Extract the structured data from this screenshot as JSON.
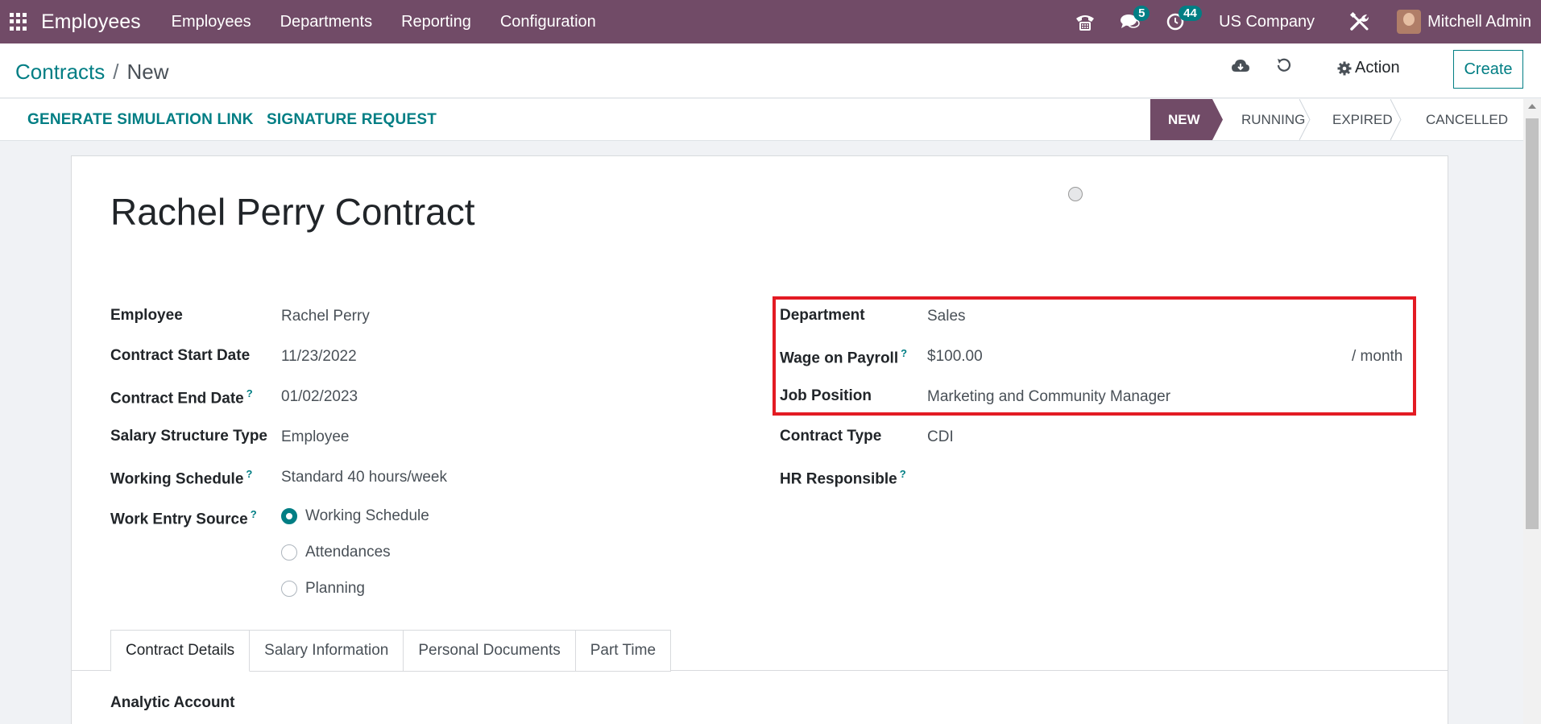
{
  "navbar": {
    "app_name": "Employees",
    "menu": [
      "Employees",
      "Departments",
      "Reporting",
      "Configuration"
    ],
    "messages_count": "5",
    "activities_count": "44",
    "company": "US Company",
    "user": "Mitchell Admin",
    "color": "#714b67"
  },
  "breadcrumb": {
    "parent": "Contracts",
    "separator": "/",
    "current": "New"
  },
  "control": {
    "action_label": "Action",
    "create_label": "Create"
  },
  "statusbar": {
    "buttons": [
      "GENERATE SIMULATION LINK",
      "SIGNATURE REQUEST"
    ],
    "stages": [
      "NEW",
      "RUNNING",
      "EXPIRED",
      "CANCELLED"
    ],
    "active_stage": "NEW"
  },
  "form": {
    "title": "Rachel Perry Contract",
    "left": {
      "employee": {
        "label": "Employee",
        "value": "Rachel Perry"
      },
      "start_date": {
        "label": "Contract Start Date",
        "value": "11/23/2022"
      },
      "end_date": {
        "label": "Contract End Date",
        "value": "01/02/2023"
      },
      "salary_structure": {
        "label": "Salary Structure Type",
        "value": "Employee"
      },
      "working_schedule": {
        "label": "Working Schedule",
        "value": "Standard 40 hours/week"
      },
      "work_entry_source": {
        "label": "Work Entry Source",
        "options": [
          "Working Schedule",
          "Attendances",
          "Planning"
        ],
        "selected": "Working Schedule"
      }
    },
    "right": {
      "department": {
        "label": "Department",
        "value": "Sales"
      },
      "wage": {
        "label": "Wage on Payroll",
        "value": "$100.00",
        "unit": "/ month"
      },
      "job_position": {
        "label": "Job Position",
        "value": "Marketing and Community Manager"
      },
      "contract_type": {
        "label": "Contract Type",
        "value": "CDI"
      },
      "hr_responsible": {
        "label": "HR Responsible",
        "value": ""
      }
    },
    "tooltip_mark": "?"
  },
  "tabs": [
    "Contract Details",
    "Salary Information",
    "Personal Documents",
    "Part Time"
  ],
  "active_tab": "Contract Details",
  "tab_content": {
    "analytic_account_label": "Analytic Account"
  },
  "colors": {
    "accent": "#017e84",
    "highlight_box": "#e31b23"
  }
}
